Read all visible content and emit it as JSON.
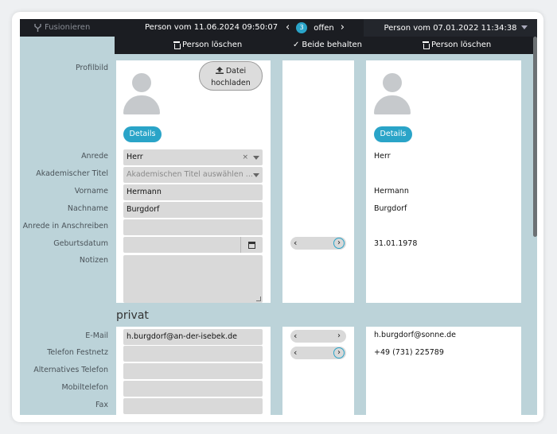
{
  "topbar": {
    "merge_label": "Fusionieren",
    "left_person": "Person vom 11.06.2024 09:50:07",
    "open_count": "3",
    "open_label": "offen",
    "prev_arrow": "‹",
    "next_arrow": "›",
    "right_person": "Person vom 07.01.2022 11:34:38"
  },
  "actions": {
    "delete_left": "Person löschen",
    "keep_both": "Beide behalten",
    "delete_right": "Person löschen"
  },
  "labels": {
    "profilbild": "Profilbild",
    "anrede": "Anrede",
    "akademischer_titel": "Akademischer Titel",
    "vorname": "Vorname",
    "nachname": "Nachname",
    "anrede_anschreiben": "Anrede in Anschreiben",
    "geburtsdatum": "Geburtsdatum",
    "notizen": "Notizen",
    "email": "E-Mail",
    "telefon_festnetz": "Telefon Festnetz",
    "alternatives_telefon": "Alternatives Telefon",
    "mobiltelefon": "Mobiltelefon",
    "fax": "Fax"
  },
  "left": {
    "upload_line1": "Datei",
    "upload_line2": "hochladen",
    "details": "Details",
    "anrede": "Herr",
    "clear_icon": "×",
    "titel_placeholder": "Akademischen Titel auswählen ...",
    "vorname": "Hermann",
    "nachname": "Burgdorf",
    "email": "h.burgdorf@an-der-isebek.de"
  },
  "right": {
    "details": "Details",
    "anrede": "Herr",
    "vorname": "Hermann",
    "nachname": "Burgdorf",
    "geburtsdatum": "31.01.1978",
    "email": "h.burgdorf@sonne.de",
    "telefon_festnetz": "+49 (731) 225789"
  },
  "section": {
    "privat": "privat"
  },
  "toggle": {
    "left_arrow": "‹",
    "right_arrow": "›"
  },
  "colors": {
    "accent": "#2aa4c8",
    "topbar": "#1b1d22",
    "background": "#bcd3d9"
  }
}
